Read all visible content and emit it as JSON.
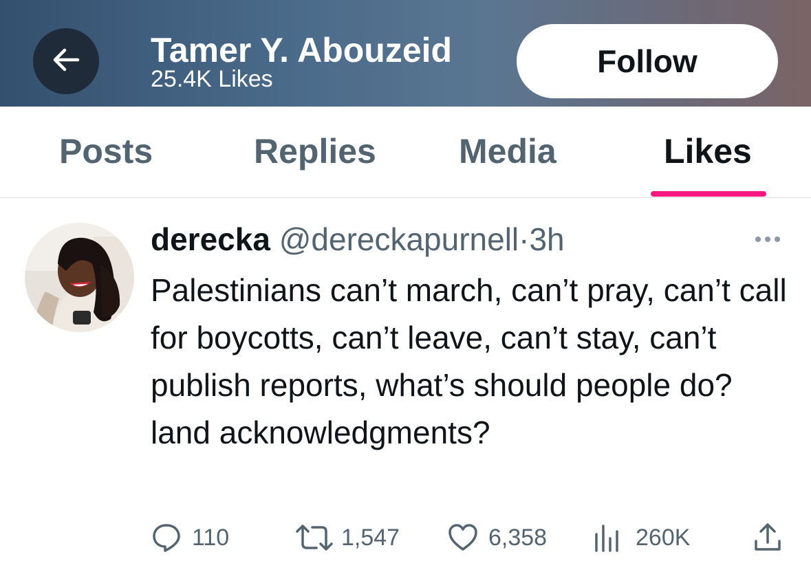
{
  "header": {
    "back_icon": "arrow-left-icon",
    "name": "Tamer Y. Abouzeid",
    "subtitle": "25.4K Likes",
    "follow_label": "Follow"
  },
  "tabs": [
    {
      "label": "Posts"
    },
    {
      "label": "Replies"
    },
    {
      "label": "Media"
    },
    {
      "label": "Likes",
      "active": true
    }
  ],
  "accent_color": "#f91880",
  "tweet": {
    "author_name": "derecka",
    "author_handle": "@dereckapurnell",
    "separator": "·",
    "time": "3h",
    "text": "Palestinians can’t march, can’t pray, can’t call for boycotts, can’t leave, can’t stay, can’t publish reports, what’s should people do? land acknowledgments?",
    "actions": {
      "replies": "110",
      "reposts": "1,547",
      "likes": "6,358",
      "views": "260K"
    }
  }
}
